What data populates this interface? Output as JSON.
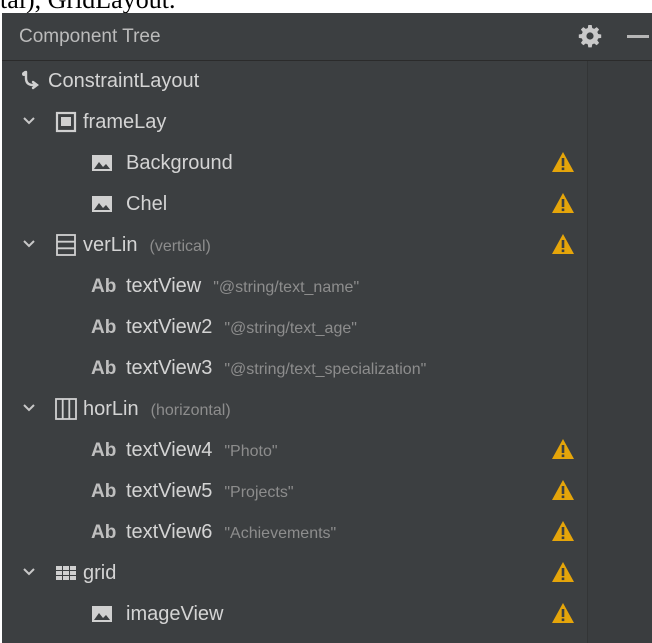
{
  "caption": "tal), GridLayout.",
  "panel": {
    "title": "Component Tree",
    "header_icons": [
      "gear-icon",
      "minimize-icon"
    ]
  },
  "tree": {
    "rows": [
      {
        "depth": 0,
        "icon": "constraint-layout-icon",
        "label": "ConstraintLayout",
        "hint": "",
        "expanded": null,
        "warning": false
      },
      {
        "depth": 0,
        "icon": "frame-layout-icon",
        "label": "frameLay",
        "hint": "",
        "expanded": true,
        "warning": false
      },
      {
        "depth": 1,
        "icon": "image-view-icon",
        "label": "Background",
        "hint": "",
        "expanded": null,
        "warning": true
      },
      {
        "depth": 1,
        "icon": "image-view-icon",
        "label": "Chel",
        "hint": "",
        "expanded": null,
        "warning": true
      },
      {
        "depth": 0,
        "icon": "linear-vertical-icon",
        "label": "verLin",
        "hint": "(vertical)",
        "expanded": true,
        "warning": true
      },
      {
        "depth": 1,
        "icon": "text-view-icon",
        "label": "textView",
        "hint": "\"@string/text_name\"",
        "expanded": null,
        "warning": false
      },
      {
        "depth": 1,
        "icon": "text-view-icon",
        "label": "textView2",
        "hint": "\"@string/text_age\"",
        "expanded": null,
        "warning": false
      },
      {
        "depth": 1,
        "icon": "text-view-icon",
        "label": "textView3",
        "hint": "\"@string/text_specialization\"",
        "expanded": null,
        "warning": false
      },
      {
        "depth": 0,
        "icon": "linear-horizontal-icon",
        "label": "horLin",
        "hint": "(horizontal)",
        "expanded": true,
        "warning": false
      },
      {
        "depth": 1,
        "icon": "text-view-icon",
        "label": "textView4",
        "hint": "\"Photo\"",
        "expanded": null,
        "warning": true
      },
      {
        "depth": 1,
        "icon": "text-view-icon",
        "label": "textView5",
        "hint": "\"Projects\"",
        "expanded": null,
        "warning": true
      },
      {
        "depth": 1,
        "icon": "text-view-icon",
        "label": "textView6",
        "hint": "\"Achievements\"",
        "expanded": null,
        "warning": true
      },
      {
        "depth": 0,
        "icon": "grid-layout-icon",
        "label": "grid",
        "hint": "",
        "expanded": true,
        "warning": true
      },
      {
        "depth": 1,
        "icon": "image-view-icon",
        "label": "imageView",
        "hint": "",
        "expanded": null,
        "warning": true
      }
    ],
    "text_view_prefix": "Ab"
  },
  "colors": {
    "panel_bg": "#3c3f41",
    "text": "#d4d4d4",
    "hint": "#8d8d8d",
    "warning": "#e5a50a",
    "icon": "#d0d0d0"
  }
}
